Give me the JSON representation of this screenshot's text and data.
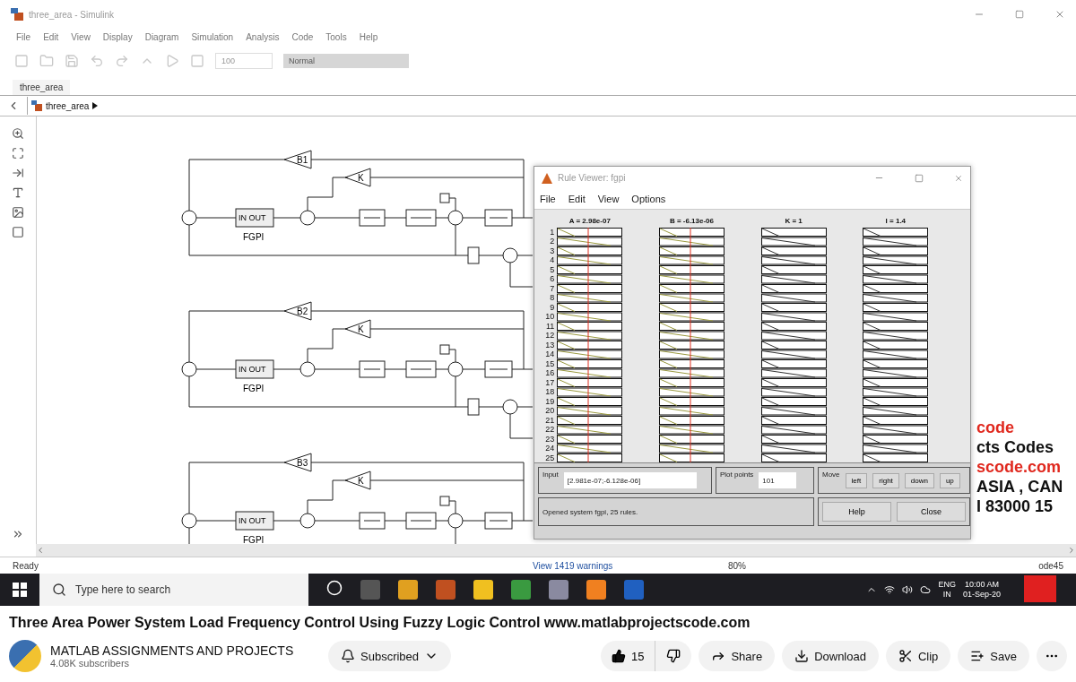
{
  "simulink": {
    "title": "three_area - Simulink",
    "menu": [
      "File",
      "Edit",
      "View",
      "Display",
      "Diagram",
      "Simulation",
      "Analysis",
      "Code",
      "Tools",
      "Help"
    ],
    "stop_time": "100",
    "sim_mode": "Normal",
    "tab": {
      "label": "three_area",
      "selected": true
    },
    "breadcrumb": "three_area",
    "diagram": {
      "areas": [
        {
          "bias": "B1",
          "gain": "K",
          "controller": "IN OUT",
          "controller_name": "FGPI"
        },
        {
          "bias": "B2",
          "gain": "K",
          "controller": "IN OUT",
          "controller_name": "FGPI"
        },
        {
          "bias": "B3",
          "gain": "K",
          "controller": "IN OUT",
          "controller_name": "FGPI"
        }
      ]
    },
    "overlay_text": [
      {
        "text": "code",
        "color": "#e0281e"
      },
      {
        "text": "cts Codes",
        "color": "#111111"
      },
      {
        "text": "scode.com",
        "color": "#e0281e"
      },
      {
        "text": "ASIA , CAN",
        "color": "#111111"
      },
      {
        "text": "I 83000 15",
        "color": "#111111"
      }
    ],
    "rule_viewer": {
      "title": "Rule Viewer: fgpi",
      "menu": [
        "File",
        "Edit",
        "View",
        "Options"
      ],
      "columns": [
        {
          "header": "A = 2.98e-07",
          "kind": "input"
        },
        {
          "header": "B = -6.13e-06",
          "kind": "input"
        },
        {
          "header": "K = 1",
          "kind": "output"
        },
        {
          "header": "I = 1.4",
          "kind": "output"
        }
      ],
      "rules": [
        "1",
        "2",
        "3",
        "4",
        "5",
        "6",
        "7",
        "8",
        "9",
        "10",
        "11",
        "12",
        "13",
        "14",
        "15",
        "16",
        "17",
        "18",
        "19",
        "20",
        "21",
        "22",
        "23",
        "24",
        "25"
      ],
      "input_label": "Input",
      "input_value": "[2.981e-07;-6.128e-06]",
      "plot_points_label": "Plot points",
      "plot_points": "101",
      "move_label": "Move",
      "move_buttons": [
        "left",
        "right",
        "down",
        "up"
      ],
      "status": "Opened system fgpi, 25 rules.",
      "buttons": [
        "Help",
        "Close"
      ]
    },
    "status_bar": {
      "left": "Ready",
      "center": "View 1419 warnings",
      "zoom": "80%",
      "solver": "ode45"
    }
  },
  "taskbar": {
    "search_placeholder": "Type here to search",
    "lang": "ENG",
    "region": "IN",
    "time": "10:00 AM",
    "date": "01-Sep-20"
  },
  "video_title": "Three Area Power System Load Frequency Control Using Fuzzy Logic Control www.matlabprojectscode.com",
  "channel": {
    "name": "MATLAB ASSIGNMENTS AND PROJECTS",
    "subscribers": "4.08K subscribers",
    "subscribe_label": "Subscribed"
  },
  "actions": {
    "likes": "15",
    "share": "Share",
    "download": "Download",
    "clip": "Clip",
    "save": "Save"
  }
}
